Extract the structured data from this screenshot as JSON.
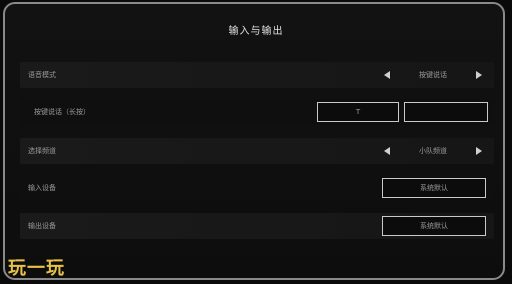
{
  "dialog": {
    "title": "输入与输出"
  },
  "rows": [
    {
      "label": "语音模式",
      "value": "按键说话"
    },
    {
      "label": "按键说话（长按）",
      "key_value": "T",
      "key_value2": ""
    },
    {
      "label": "选择频道",
      "value": "小队频道"
    },
    {
      "label": "输入设备",
      "button": "系统默认"
    },
    {
      "label": "输出设备",
      "button": "系统默认"
    }
  ],
  "watermark": {
    "text": "玩一玩",
    "color": "#e8c14a"
  },
  "colors": {
    "accent_border": "#c9c9c9",
    "frame": "#8a8a8a"
  }
}
